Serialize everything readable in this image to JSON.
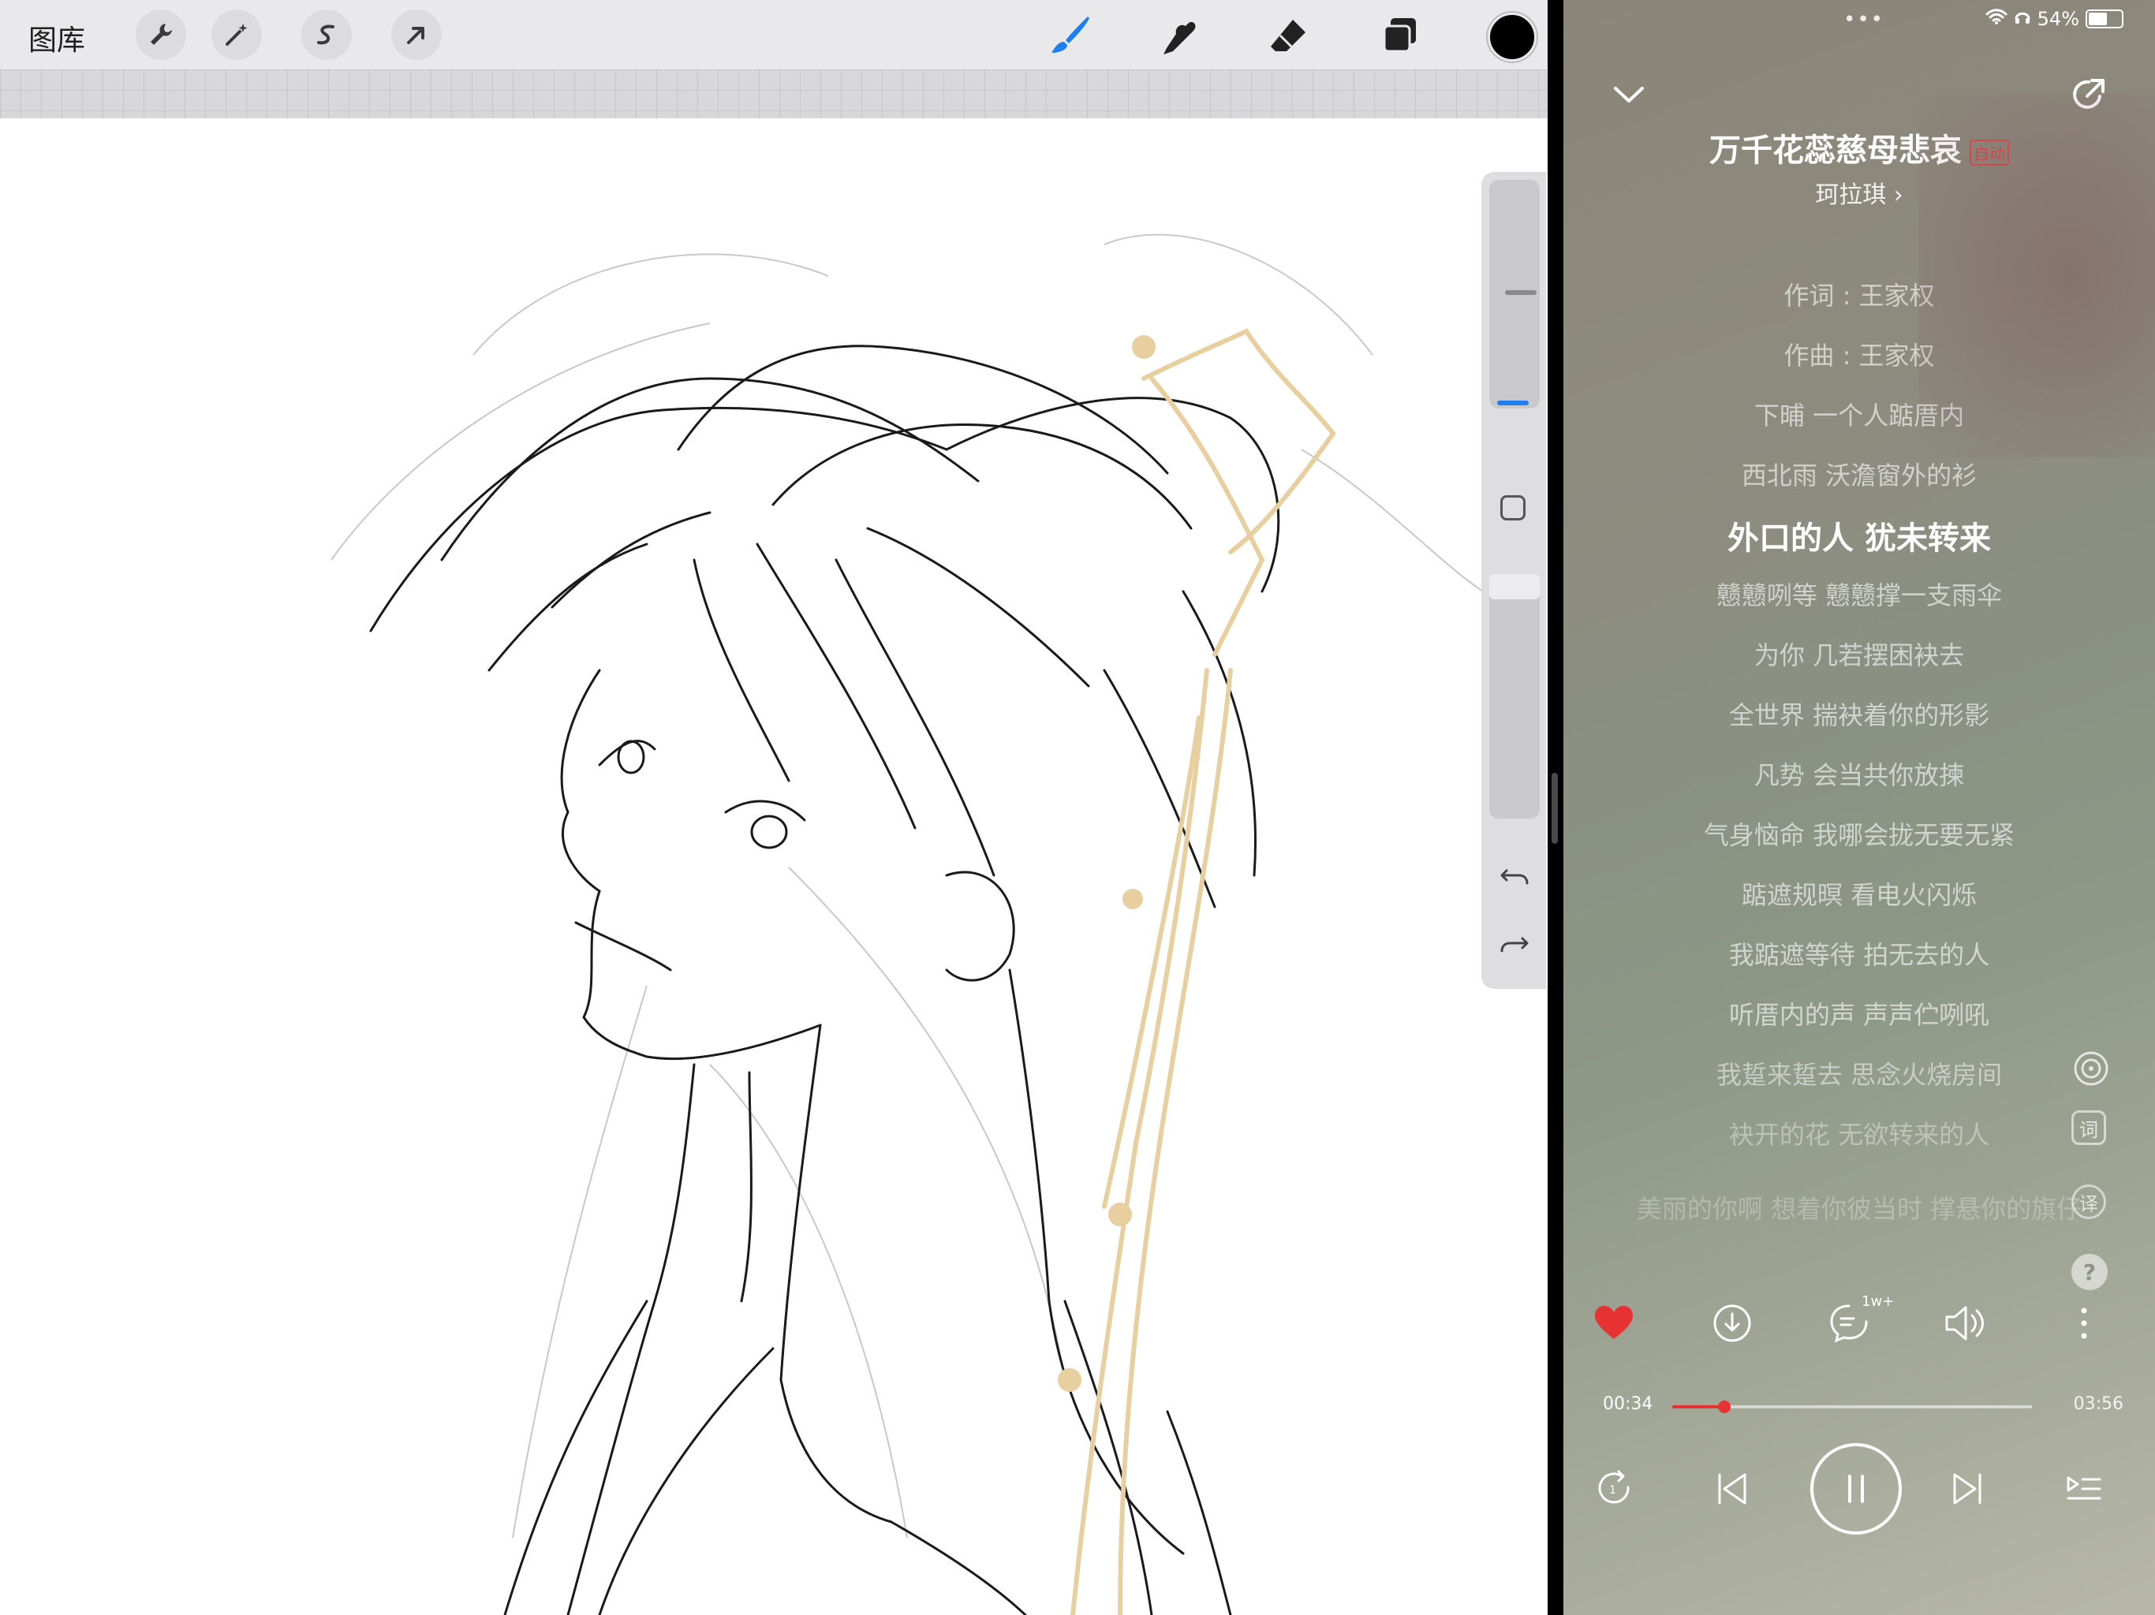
{
  "drawing_app": {
    "gallery_label": "图库",
    "toolbar_icons": [
      "wrench-icon",
      "magic-wand-icon",
      "selection-icon",
      "transform-arrow-icon"
    ],
    "right_tools": [
      "brush-icon",
      "smudge-icon",
      "eraser-icon",
      "layers-icon"
    ],
    "current_color": "#000000",
    "accent_color": "#1f7ff0",
    "hair_ornament_color": "#e8cfa0"
  },
  "music_player": {
    "status": {
      "battery": "54%"
    },
    "song": {
      "title": "万千花蕊慈母悲哀",
      "tag": "自动",
      "artist": "珂拉琪 ›"
    },
    "lyrics": [
      "作词 : 王家权",
      "作曲 : 王家权",
      "下晡 一个人踮厝内",
      "西北雨 沃澹窗外的衫",
      "外口的人 犹未转来",
      "戆戆咧等 戆戆撑一支雨伞",
      "为你 几若摆困袂去",
      "全世界 揣袂着你的形影",
      "凡势 会当共你放揀",
      "气身恼命 我哪会拢无要无紧",
      "踮遮规暝 看电火闪烁",
      "我踮遮等待 拍无去的人",
      "听厝内的声 声声伫咧吼",
      "我踅来踅去 思念火烧房间",
      "袂开的花 无欲转来的人",
      "美丽的你啊 想着你彼当时 撑悬你的旗仔"
    ],
    "active_lyric_index": 4,
    "side_tools": [
      "vinyl-icon",
      "lyrics-char-icon",
      "lyrics-translate-icon",
      "help-icon"
    ],
    "side_tool_labels": {
      "lyrics_char": "词",
      "translate": "译",
      "help": "?"
    },
    "comment_count": "1w+",
    "time_current": "00:34",
    "time_total": "03:56",
    "progress": 0.144,
    "liked": true,
    "like_color": "#e63232"
  }
}
